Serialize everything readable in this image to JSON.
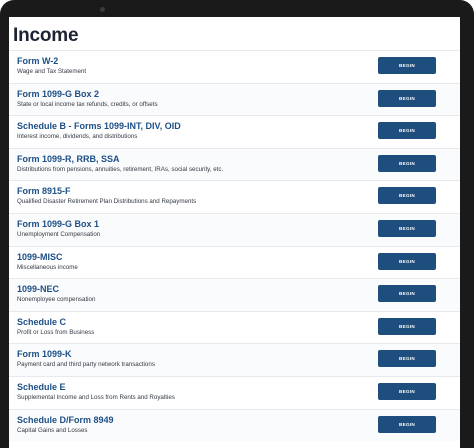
{
  "page": {
    "title": "Income"
  },
  "button_label": "BEGIN",
  "items": [
    {
      "title": "Form W-2",
      "subtitle": "Wage and Tax Statement"
    },
    {
      "title": "Form 1099-G Box 2",
      "subtitle": "State or local income tax refunds, credits, or offsets"
    },
    {
      "title": "Schedule B - Forms 1099-INT, DIV, OID",
      "subtitle": "Interest income, dividends, and distributions"
    },
    {
      "title": "Form 1099-R, RRB, SSA",
      "subtitle": "Distributions from pensions, annuities, retirement, IRAs, social security, etc."
    },
    {
      "title": "Form 8915-F",
      "subtitle": "Qualified Disaster Retirement Plan Distributions and Repayments"
    },
    {
      "title": "Form 1099-G Box 1",
      "subtitle": "Unemployment Compensation"
    },
    {
      "title": "1099-MISC",
      "subtitle": "Miscellaneous income"
    },
    {
      "title": "1099-NEC",
      "subtitle": "Nonemployee compensation"
    },
    {
      "title": "Schedule C",
      "subtitle": "Profit or Loss from Business"
    },
    {
      "title": "Form 1099-K",
      "subtitle": "Payment card and third party network transactions"
    },
    {
      "title": "Schedule E",
      "subtitle": "Supplemental Income and Loss from Rents and Royalties"
    },
    {
      "title": "Schedule D/Form 8949",
      "subtitle": "Capital Gains and Losses"
    }
  ]
}
